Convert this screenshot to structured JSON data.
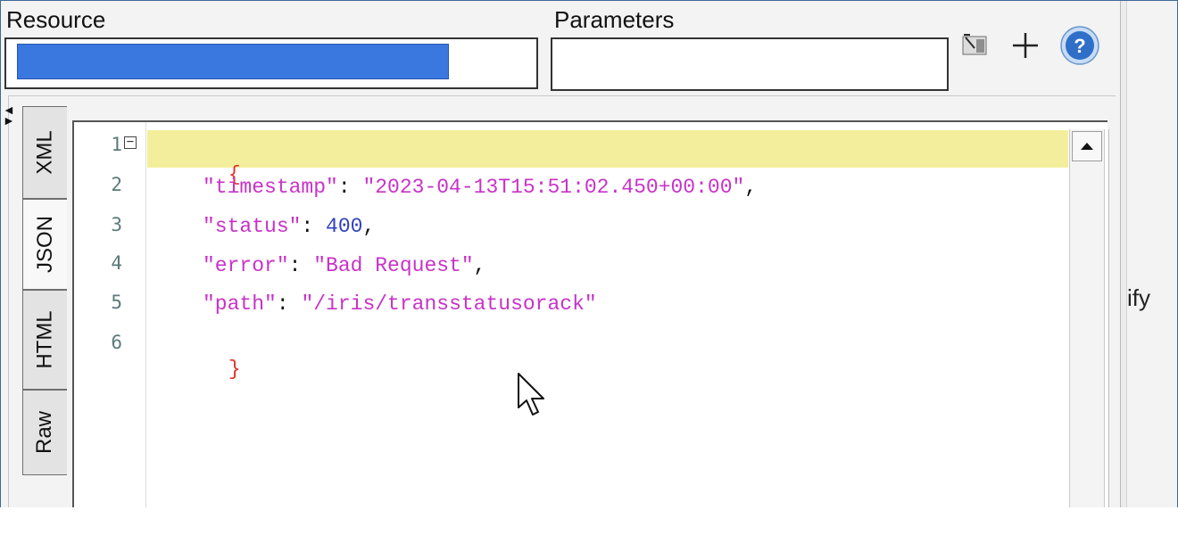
{
  "toolbar": {
    "resource_label": "Resource",
    "parameters_label": "Parameters",
    "resource_value": "",
    "parameters_value": "",
    "icons": [
      "edit-params-icon",
      "add-icon",
      "help-icon"
    ]
  },
  "tabs": [
    "XML",
    "JSON",
    "HTML",
    "Raw"
  ],
  "active_tab": "JSON",
  "right_panel": {
    "partial_text": "ify"
  },
  "editor": {
    "line_numbers": [
      "1",
      "2",
      "3",
      "4",
      "5",
      "6"
    ],
    "lines": {
      "l1": "{",
      "l2_key": "\"timestamp\"",
      "l2_sep": ": ",
      "l2_val": "\"2023-04-13T15:51:02.450+00:00\"",
      "l2_end": ",",
      "l3_key": "\"status\"",
      "l3_sep": ": ",
      "l3_val": "400",
      "l3_end": ",",
      "l4_key": "\"error\"",
      "l4_sep": ": ",
      "l4_val": "\"Bad Request\"",
      "l4_end": ",",
      "l5_key": "\"path\"",
      "l5_sep": ": ",
      "l5_val": "\"/iris/transstatusorack\"",
      "l6": "}"
    }
  },
  "colors": {
    "brace": "#e0332a",
    "key_string": "#c832c8",
    "number": "#2f3fbf",
    "punct": "#111111",
    "highlight": "#f3ee9c",
    "selection": "#3a78e0"
  }
}
